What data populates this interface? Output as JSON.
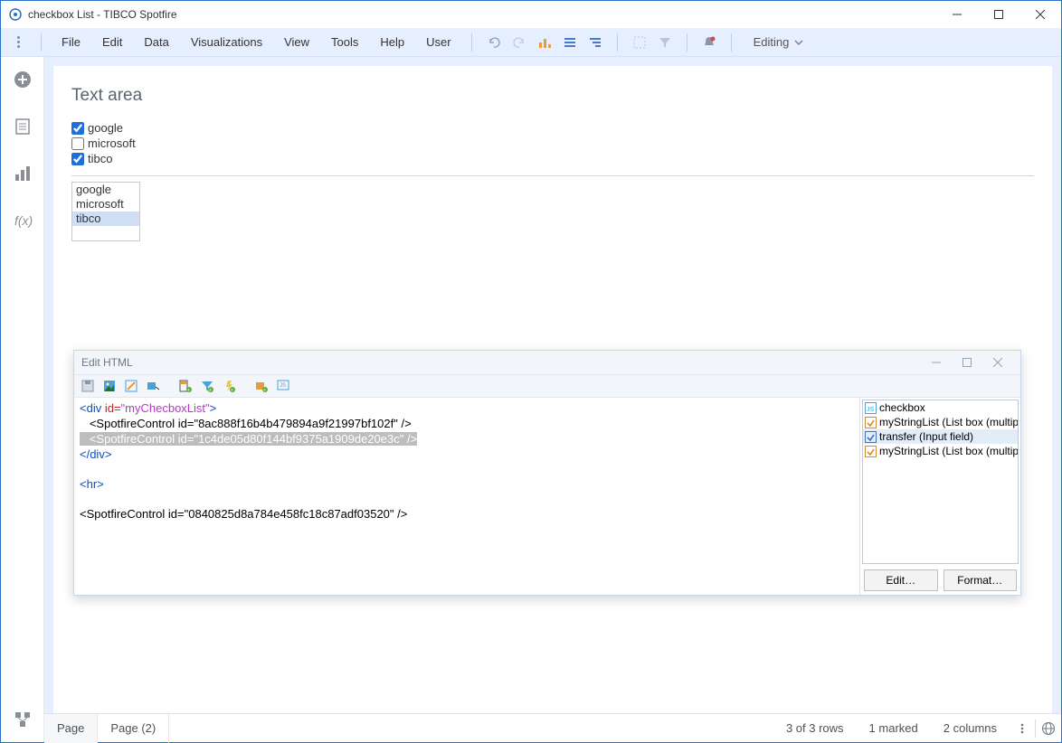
{
  "window": {
    "title": "checkbox List - TIBCO Spotfire"
  },
  "menubar": {
    "items": [
      "File",
      "Edit",
      "Data",
      "Visualizations",
      "View",
      "Tools",
      "Help",
      "User"
    ],
    "mode_label": "Editing"
  },
  "panel": {
    "title": "Text area",
    "checkboxes": [
      {
        "label": "google",
        "checked": true
      },
      {
        "label": "microsoft",
        "checked": false
      },
      {
        "label": "tibco",
        "checked": true
      }
    ],
    "listbox": [
      {
        "label": "google",
        "selected": false
      },
      {
        "label": "microsoft",
        "selected": false
      },
      {
        "label": "tibco",
        "selected": true
      }
    ]
  },
  "dialog": {
    "title": "Edit HTML",
    "code": {
      "line1_open": "<div ",
      "line1_attr": "id=",
      "line1_val": "\"myChecboxList\"",
      "line1_close": ">",
      "line2": "   <SpotfireControl id=\"8ac888f16b4b479894a9f21997bf102f\" />",
      "line3": "   <SpotfireControl id=\"1c4de05d80f144bf9375a1909de20e3c\" />",
      "line4": "</div>",
      "line5": "",
      "line6": "<hr>",
      "line7": "",
      "line8": "<SpotfireControl id=\"0840825d8a784e458fc18c87adf03520\" />"
    },
    "right_items": [
      {
        "type": "js",
        "label": "checkbox"
      },
      {
        "type": "ctrl",
        "label": "myStringList (List box (multiple se"
      },
      {
        "type": "ctrl",
        "label": "transfer (Input field)"
      },
      {
        "type": "ctrl",
        "label": "myStringList (List box (multiple se"
      }
    ],
    "edit_btn": "Edit…",
    "format_btn": "Format…"
  },
  "footer": {
    "tabs": [
      "Page",
      "Page (2)"
    ],
    "rows": "3 of 3 rows",
    "marked": "1 marked",
    "columns": "2 columns"
  }
}
